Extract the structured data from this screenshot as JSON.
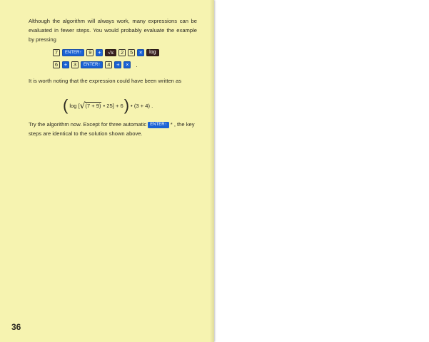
{
  "page": {
    "page_number": "36",
    "paragraph1": "Although the algorithm will always work, many expressions can be evaluated in fewer steps. You would probably evaluate the example by pressing",
    "keys_row1": [
      "7",
      "ENTER↑",
      "9",
      "+",
      "√x",
      "2",
      "5",
      "×",
      "log"
    ],
    "keys_row2": [
      "6",
      "+",
      "3",
      "ENTER↑",
      "4",
      "+",
      "×"
    ],
    "keys_row2_trail": ".",
    "paragraph2": "It is worth noting that the expression could have been written as",
    "formula": {
      "open_paren": "(",
      "part1": "log [",
      "sqrt_symbol": "√",
      "radicand": "(7 + 9)",
      "part2": "• 25] + 6",
      "close_paren": ")",
      "part3": "• (3 + 4) ."
    },
    "paragraph3_before": "Try the algorithm now. Except for three automatic",
    "paragraph3_key": "ENTER↑",
    "paragraph3_after": "* , the key steps are identical to the solution shown above."
  }
}
